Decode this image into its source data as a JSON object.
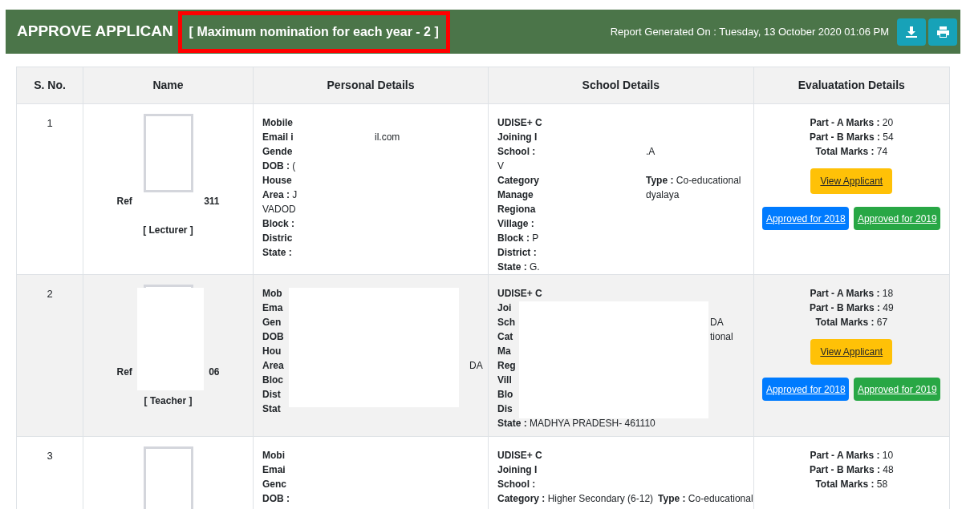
{
  "header": {
    "title": "APPROVE APPLICAN",
    "note": "[  Maximum nomination for each year - 2  ]",
    "note_highlighted": true,
    "report": "Report Generated On : Tuesday, 13 October 2020 01:06 PM"
  },
  "table": {
    "columns": [
      "S. No.",
      "Name",
      "Personal Details",
      "School Details",
      "Evaluatation Details"
    ],
    "rows": [
      {
        "sno": "1",
        "redacted": false,
        "ref": [
          "Ref",
          "311"
        ],
        "role": "[ Lecturer ]",
        "personal": [
          {
            "label": "Mobile"
          },
          {
            "label": "Email i",
            "tail": "il.com"
          },
          {
            "label": "Gende"
          },
          {
            "label": "DOB :",
            "value": "("
          },
          {
            "label": "House"
          },
          {
            "label": "Area :",
            "value": "J"
          },
          {
            "value": "VADOD"
          },
          {
            "label": "Block :"
          },
          {
            "label": "Distric"
          },
          {
            "label": "State :"
          }
        ],
        "school": [
          {
            "label": "UDISE+ C"
          },
          {
            "label": "Joining I"
          },
          {
            "label": "School :",
            "tail": ".A"
          },
          {
            "value": "V"
          },
          {
            "label": "Category",
            "side_label": "Type :",
            "side_value": "Co-educational"
          },
          {
            "label": "Manage",
            "side_value": "dyalaya"
          },
          {
            "label": "Regiona"
          },
          {
            "label": "Village :"
          },
          {
            "label": "Block :",
            "value": "P"
          },
          {
            "label": "District :"
          },
          {
            "label": "State :",
            "value": "G."
          }
        ],
        "marks": [
          {
            "label": "Part - A Marks :",
            "value": "20"
          },
          {
            "label": "Part - B Marks :",
            "value": "54"
          },
          {
            "label": "Total Marks :",
            "value": "74"
          }
        ],
        "buttons": [
          "View Applicant",
          "Approved for 2018",
          "Approved for 2019"
        ]
      },
      {
        "sno": "2",
        "redacted": true,
        "ref": [
          "Ref",
          "06"
        ],
        "role": "[ Teacher ]",
        "personal": [
          {
            "label": "Mob"
          },
          {
            "label": "Ema"
          },
          {
            "label": "Gen"
          },
          {
            "label": "DOB"
          },
          {
            "label": "Hou"
          },
          {
            "label": "Area",
            "tail": "DA"
          },
          {
            "label": "Bloc"
          },
          {
            "label": "Dist"
          },
          {
            "label": "Stat"
          }
        ],
        "school": [
          {
            "label": "UDISE+ C"
          },
          {
            "label": "Joi"
          },
          {
            "label": "Sch",
            "tail": "DA"
          },
          {
            "label": "Cat",
            "tail": "tional"
          },
          {
            "label": "Ma"
          },
          {
            "label": "Reg"
          },
          {
            "label": "Vill"
          },
          {
            "label": "Blo"
          },
          {
            "label": "Dis"
          },
          {
            "label": "State :",
            "value": "MADHYA PRADESH- 461110"
          }
        ],
        "marks": [
          {
            "label": "Part - A Marks :",
            "value": "18"
          },
          {
            "label": "Part - B Marks :",
            "value": "49"
          },
          {
            "label": "Total Marks :",
            "value": "67"
          }
        ],
        "buttons": [
          "View Applicant",
          "Approved for 2018",
          "Approved for 2019"
        ]
      },
      {
        "sno": "3",
        "redacted": false,
        "personal": [
          {
            "label": "Mobi"
          },
          {
            "label": "Emai"
          },
          {
            "label": "Genc"
          },
          {
            "label": "DOB :"
          }
        ],
        "school": [
          {
            "label": "UDISE+ C"
          },
          {
            "label": "Joining I"
          },
          {
            "label": "School :"
          },
          {
            "label": "Category :",
            "value": "Higher Secondary (6-12)",
            "inline": true,
            "side_label": "Type :",
            "side_value": "Co-educational"
          }
        ],
        "marks": [
          {
            "label": "Part - A Marks :",
            "value": "10"
          },
          {
            "label": "Part - B Marks :",
            "value": "48"
          },
          {
            "label": "Total Marks :",
            "value": "58"
          }
        ],
        "buttons": []
      }
    ]
  }
}
